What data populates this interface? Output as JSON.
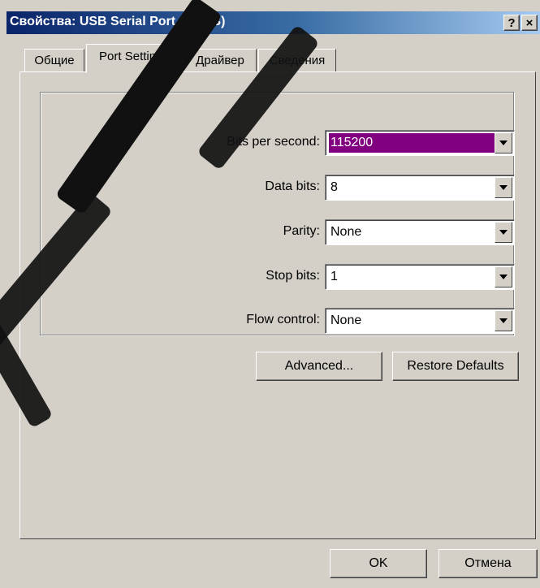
{
  "window": {
    "title": "Свойства: USB Serial Port (COM3)",
    "help_label": "?",
    "close_label": "×"
  },
  "tabs": [
    {
      "label": "Общие",
      "active": false
    },
    {
      "label": "Port Settings",
      "active": true
    },
    {
      "label": "Драйвер",
      "active": false
    },
    {
      "label": "Сведения",
      "active": false
    }
  ],
  "settings": {
    "bits_per_second": {
      "label": "Bits per second:",
      "value": "115200"
    },
    "data_bits": {
      "label": "Data bits:",
      "value": "8"
    },
    "parity": {
      "label": "Parity:",
      "value": "None"
    },
    "stop_bits": {
      "label": "Stop bits:",
      "value": "1"
    },
    "flow_control": {
      "label": "Flow control:",
      "value": "None"
    }
  },
  "buttons": {
    "advanced": "Advanced...",
    "restore_defaults": "Restore Defaults",
    "ok": "OK",
    "cancel": "Отмена"
  },
  "colors": {
    "selection": "#800080",
    "face": "#d4d0c8",
    "title_start": "#0a246a",
    "title_end": "#a6caf0"
  }
}
